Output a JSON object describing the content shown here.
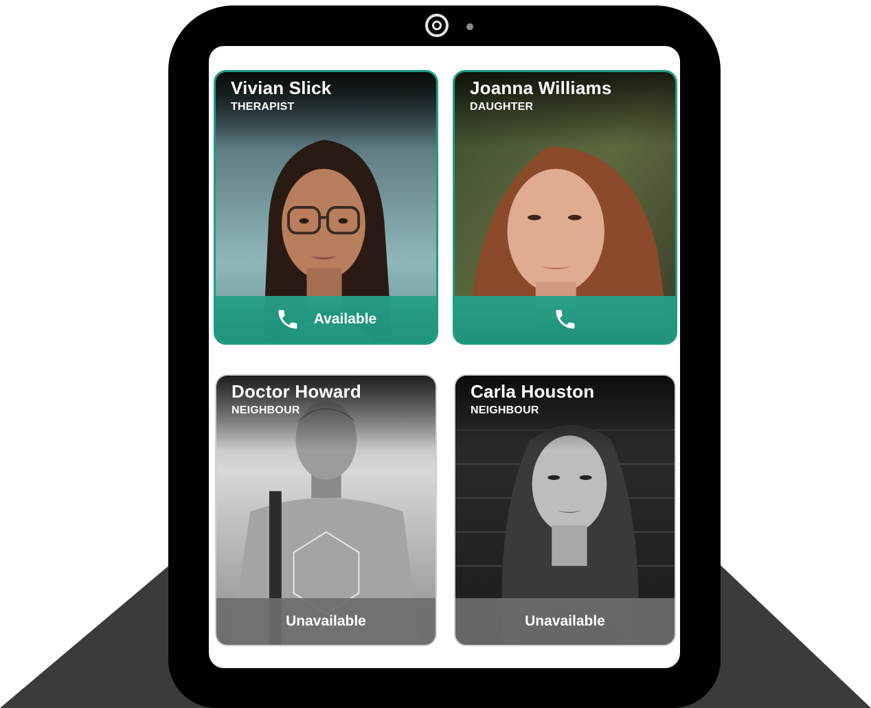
{
  "colors": {
    "available_accent": "#1d9c83",
    "unavailable_bar": "#6c6c6c",
    "tablet_frame": "#000000",
    "stand": "#3b3b3b"
  },
  "contacts": [
    {
      "name": "Vivian Slick",
      "role": "THERAPIST",
      "status_label": "Available",
      "status": "available",
      "photo": "woman-with-glasses-portrait"
    },
    {
      "name": "Joanna Williams",
      "role": "DAUGHTER",
      "status_label": "",
      "status": "available",
      "photo": "woman-with-long-hair-portrait"
    },
    {
      "name": "Doctor Howard",
      "role": "NEIGHBOUR",
      "status_label": "Unavailable",
      "status": "unavailable",
      "photo": "man-with-backpack-portrait-grayscale"
    },
    {
      "name": "Carla Houston",
      "role": "NEIGHBOUR",
      "status_label": "Unavailable",
      "status": "unavailable",
      "photo": "woman-against-brick-wall-grayscale"
    }
  ],
  "icons": {
    "call": "phone-icon",
    "camera": "front-camera-icon"
  }
}
